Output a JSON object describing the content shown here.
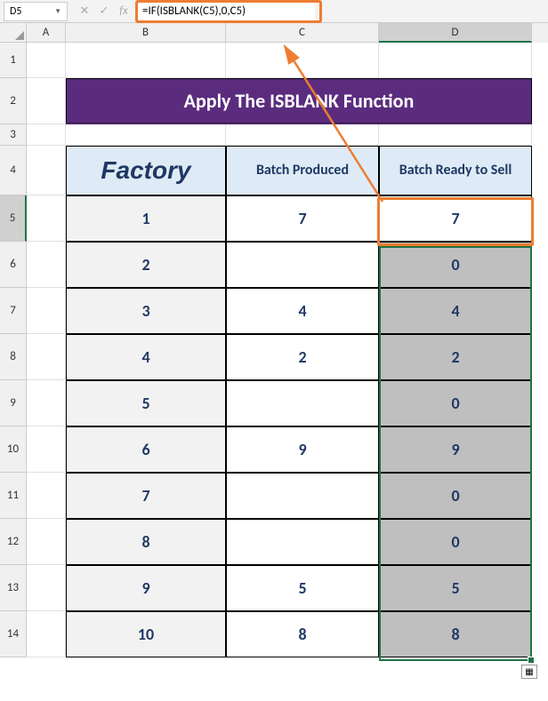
{
  "nameBox": "D5",
  "formula": "=IF(ISBLANK(C5),0,C5)",
  "columns": [
    "A",
    "B",
    "C",
    "D"
  ],
  "title": "Apply The ISBLANK Function",
  "headers": {
    "factory": "Factory",
    "produced": "Batch Produced",
    "ready": "Batch Ready to Sell"
  },
  "rows": [
    {
      "n": 5,
      "factory": "1",
      "produced": "7",
      "ready": "7"
    },
    {
      "n": 6,
      "factory": "2",
      "produced": "",
      "ready": "0"
    },
    {
      "n": 7,
      "factory": "3",
      "produced": "4",
      "ready": "4"
    },
    {
      "n": 8,
      "factory": "4",
      "produced": "2",
      "ready": "2"
    },
    {
      "n": 9,
      "factory": "5",
      "produced": "",
      "ready": "0"
    },
    {
      "n": 10,
      "factory": "6",
      "produced": "9",
      "ready": "9"
    },
    {
      "n": 11,
      "factory": "7",
      "produced": "",
      "ready": "0"
    },
    {
      "n": 12,
      "factory": "8",
      "produced": "",
      "ready": "0"
    },
    {
      "n": 13,
      "factory": "9",
      "produced": "5",
      "ready": "5"
    },
    {
      "n": 14,
      "factory": "10",
      "produced": "8",
      "ready": "8"
    }
  ],
  "chart_data": {
    "type": "table",
    "title": "Apply The ISBLANK Function",
    "columns": [
      "Factory",
      "Batch Produced",
      "Batch Ready to Sell"
    ],
    "data": [
      [
        1,
        7,
        7
      ],
      [
        2,
        null,
        0
      ],
      [
        3,
        4,
        4
      ],
      [
        4,
        2,
        2
      ],
      [
        5,
        null,
        0
      ],
      [
        6,
        9,
        9
      ],
      [
        7,
        null,
        0
      ],
      [
        8,
        null,
        0
      ],
      [
        9,
        5,
        5
      ],
      [
        10,
        8,
        8
      ]
    ],
    "formula_D5": "=IF(ISBLANK(C5),0,C5)"
  }
}
